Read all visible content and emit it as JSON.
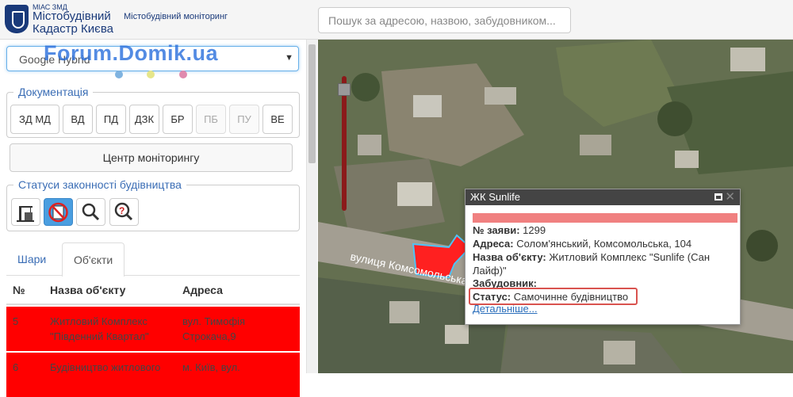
{
  "header": {
    "logo_small": "МІАС ЗМД",
    "logo_line1": "Містобудівний",
    "logo_line2": "Кадастр Києва",
    "subtitle": "Містобудівний моніторинг",
    "search_placeholder": "Пошук за адресою, назвою, забудовником..."
  },
  "sidebar": {
    "layer_select": "Google Hybrid",
    "watermark": "Forum.Domik.ua",
    "dots": [
      "#3a87c8",
      "#d8d84a",
      "#d9538a"
    ],
    "documentation": {
      "legend": "Документація",
      "buttons": [
        {
          "label": "ЗД МД",
          "enabled": true
        },
        {
          "label": "ВД",
          "enabled": true
        },
        {
          "label": "ПД",
          "enabled": true
        },
        {
          "label": "ДЗК",
          "enabled": true
        },
        {
          "label": "БР",
          "enabled": true
        },
        {
          "label": "ПБ",
          "enabled": false
        },
        {
          "label": "ПУ",
          "enabled": false
        },
        {
          "label": "ВЕ",
          "enabled": true
        }
      ]
    },
    "monitor_button": "Центр моніторингу",
    "statuses": {
      "legend": "Статуси законності будівництва",
      "icons": [
        "crane-icon",
        "no-building-icon",
        "magnifier-icon",
        "question-magnifier-icon"
      ]
    },
    "tabs": [
      {
        "label": "Шари",
        "active": false
      },
      {
        "label": "Об'єкти",
        "active": true
      }
    ],
    "table": {
      "headers": [
        "№",
        "Назва об'єкту",
        "Адреса"
      ],
      "rows": [
        {
          "num": "5",
          "name": "Житловий Комплекс \"Південний Квартал\"",
          "address": "вул. Тимофія Строкача,9"
        },
        {
          "num": "6",
          "name": "Будівництво житлового",
          "address": "м. Київ, вул."
        }
      ]
    }
  },
  "map": {
    "street_label": "вулиця Комсомольська",
    "popup": {
      "title": "ЖК Sunlife",
      "app_label": "№ заяви:",
      "app_value": "1299",
      "address_label": "Адреса:",
      "address_value": "Солом'янський, Комсомольська, 104",
      "name_label": "Назва об'єкту:",
      "name_value": "Житловий Комплекс \"Sunlife (Сан Лайф)\"",
      "builder_label": "Забудовник:",
      "status_label": "Статус:",
      "status_value": "Самочинне будівництво",
      "details_link": "Детальніше..."
    }
  }
}
